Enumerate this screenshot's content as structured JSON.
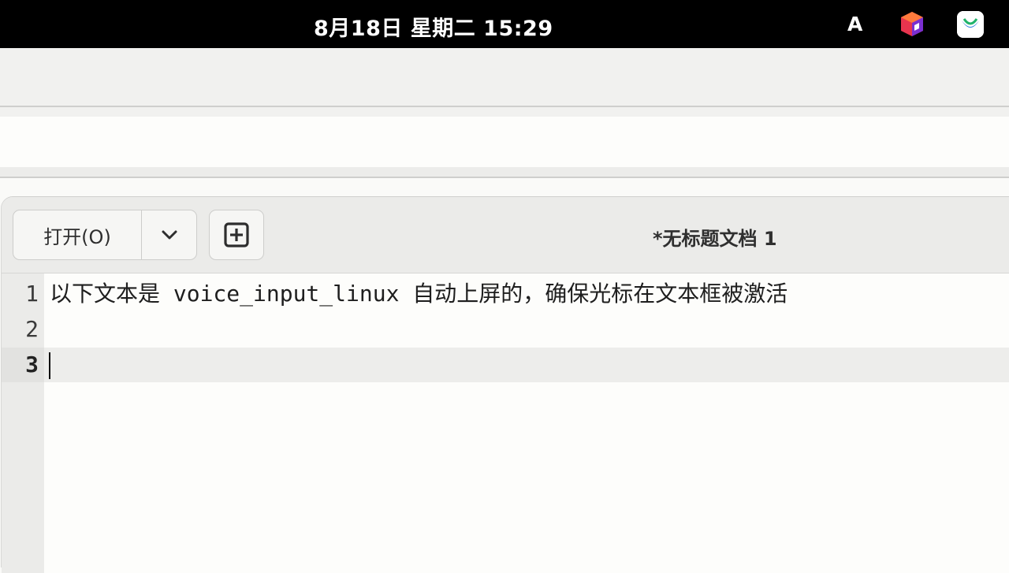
{
  "topbar": {
    "clock": "8月18日 星期二  15:29",
    "input_method": "A",
    "icons": [
      "app-cube-icon",
      "app-tray-icon"
    ]
  },
  "header": {
    "open_label": "打开(O)",
    "dropdown_icon": "chevron-down-icon",
    "new_tab_icon": "new-document-icon",
    "title": "*无标题文档 1"
  },
  "editor": {
    "lines": [
      {
        "number": "1",
        "text": "以下文本是 voice_input_linux 自动上屏的，确保光标在文本框被激活"
      },
      {
        "number": "2",
        "text": ""
      },
      {
        "number": "3",
        "text": ""
      }
    ],
    "current_line": 3
  },
  "colors": {
    "topbar": "#000000",
    "headerbar": "#ebebe9",
    "editor_bg": "#fdfdfb",
    "current_line": "#ededeb"
  }
}
